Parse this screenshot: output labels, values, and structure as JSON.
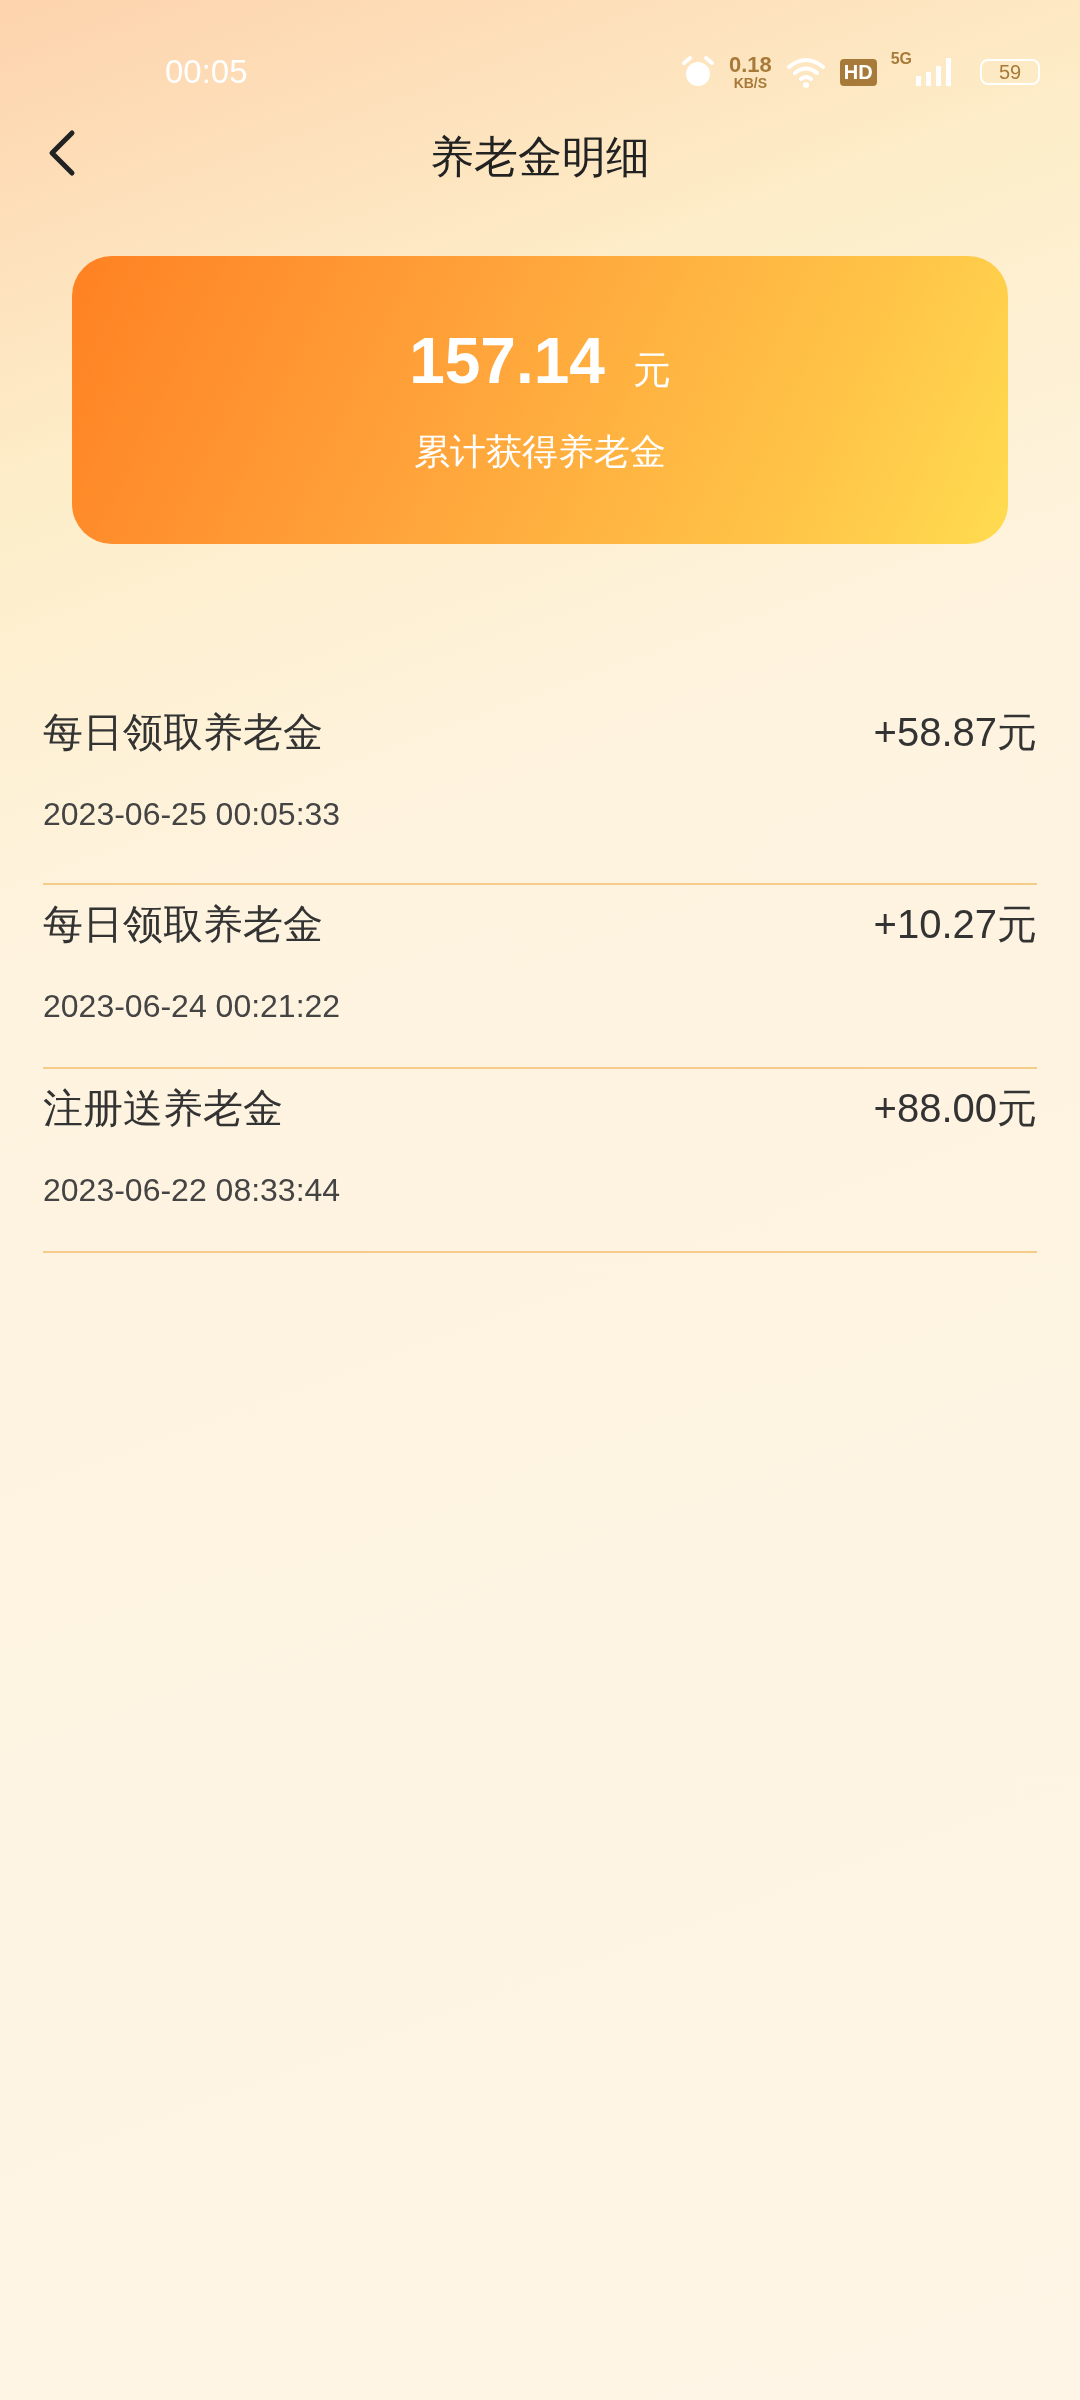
{
  "status_bar": {
    "time": "00:05",
    "speed_value": "0.18",
    "speed_unit": "KB/S",
    "hd": "HD",
    "network": "5G",
    "battery": "59"
  },
  "nav": {
    "title": "养老金明细"
  },
  "summary": {
    "amount": "157.14",
    "unit": "元",
    "label": "累计获得养老金"
  },
  "records": [
    {
      "title": "每日领取养老金",
      "amount": "+58.87元",
      "time": "2023-06-25 00:05:33"
    },
    {
      "title": "每日领取养老金",
      "amount": "+10.27元",
      "time": "2023-06-24 00:21:22"
    },
    {
      "title": "注册送养老金",
      "amount": "+88.00元",
      "time": "2023-06-22 08:33:44"
    }
  ]
}
